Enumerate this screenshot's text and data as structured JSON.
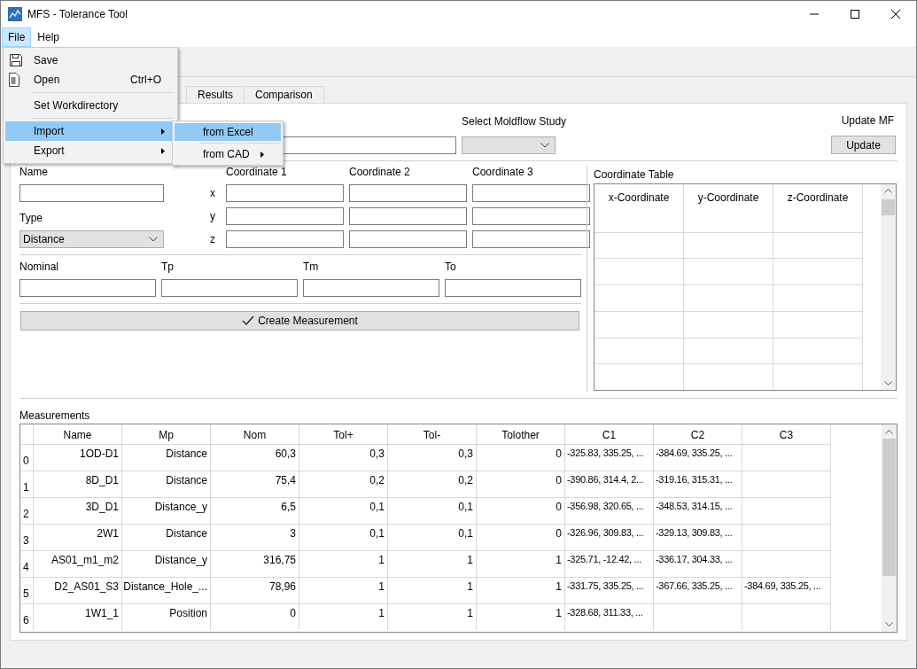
{
  "window": {
    "title": "MFS - Tolerance Tool"
  },
  "menu_bar": [
    {
      "label": "File",
      "selected": true
    },
    {
      "label": "Help",
      "selected": false
    }
  ],
  "file_menu": [
    {
      "kind": "command",
      "label": "Save",
      "selected": false
    },
    {
      "kind": "command",
      "label": "Open",
      "shortcut": "Ctrl+O",
      "selected": false
    },
    {
      "kind": "separator"
    },
    {
      "kind": "command",
      "label": "Set Workdirectory",
      "selected": false
    },
    {
      "kind": "separator"
    },
    {
      "kind": "submenu",
      "label": "Import",
      "selected": true
    },
    {
      "kind": "submenu",
      "label": "Export",
      "selected": false
    }
  ],
  "import_submenu": [
    {
      "kind": "command",
      "label": "from Excel",
      "selected": true
    },
    {
      "kind": "separator"
    },
    {
      "kind": "submenu",
      "label": "from CAD",
      "selected": false
    }
  ],
  "tabs": [
    {
      "label": "Results",
      "selected": false
    },
    {
      "label": "Comparison",
      "selected": false
    }
  ],
  "study": {
    "label": "Select Moldflow Study"
  },
  "update": {
    "label": "Update MF",
    "button": "Update"
  },
  "measurement_form": {
    "name_label": "Name",
    "type_label": "Type",
    "type_value": "Distance",
    "axes": [
      "x",
      "y",
      "z"
    ],
    "coordinate_labels": [
      "Coordinate 1",
      "Coordinate 2",
      "Coordinate 3"
    ],
    "tolerance_labels": [
      "Nominal",
      "Tp",
      "Tm",
      "To"
    ],
    "create_button": "Create Measurement"
  },
  "coordinate_table": {
    "title": "Coordinate Table",
    "columns": [
      "x-Coordinate",
      "y-Coordinate",
      "z-Coordinate"
    ]
  },
  "measurements": {
    "title": "Measurements",
    "columns": [
      "Name",
      "Mp",
      "Nom",
      "Tol+",
      "Tol-",
      "Tolother",
      "C1",
      "C2",
      "C3"
    ],
    "rows": [
      {
        "index": "0",
        "cells": [
          "1OD-D1",
          "Distance",
          "60,3",
          "0,3",
          "0,3",
          "0",
          "-325.83, 335.25, ...",
          "-384.69, 335.25, ..."
        ]
      },
      {
        "index": "1",
        "cells": [
          "8D_D1",
          "Distance",
          "75,4",
          "0,2",
          "0,2",
          "0",
          "-390.86, 314.4, 2...",
          "-319.16, 315.31, ..."
        ]
      },
      {
        "index": "2",
        "cells": [
          "3D_D1",
          "Distance_y",
          "6,5",
          "0,1",
          "0,1",
          "0",
          "-356.98, 320.65, ...",
          "-348.53, 314.15, ..."
        ]
      },
      {
        "index": "3",
        "cells": [
          "2W1",
          "Distance",
          "3",
          "0,1",
          "0,1",
          "0",
          "-326.96, 309.83, ...",
          "-329.13, 309.83, ..."
        ]
      },
      {
        "index": "4",
        "cells": [
          "AS01_m1_m2",
          "Distance_y",
          "316,75",
          "1",
          "1",
          "1",
          "-325.71, -12.42, ...",
          "-336.17, 304.33, ..."
        ]
      },
      {
        "index": "5",
        "cells": [
          "D2_AS01_S3",
          "Distance_Hole_...",
          "78,96",
          "1",
          "1",
          "1",
          "-331.75, 335.25, ...",
          "-367.66, 335.25, ...",
          "-384.69, 335.25, ..."
        ]
      },
      {
        "index": "6",
        "cells": [
          "1W1_1",
          "Position",
          "0",
          "1",
          "1",
          "1",
          "-328.68, 311.33, ..."
        ]
      }
    ]
  }
}
